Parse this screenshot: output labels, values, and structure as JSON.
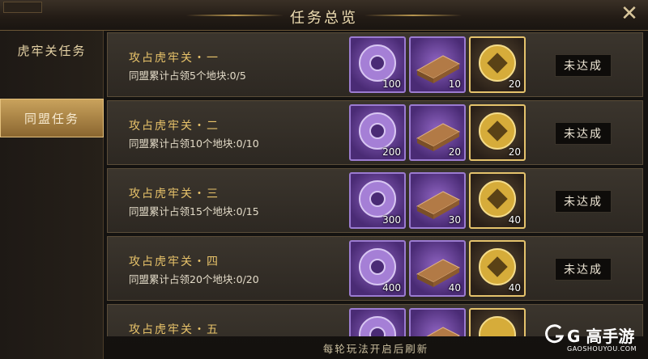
{
  "header": {
    "title": "任务总览",
    "close_icon": "close-icon"
  },
  "sidebar": {
    "items": [
      {
        "label": "虎牢关任务",
        "active": false
      },
      {
        "label": "同盟任务",
        "active": true
      }
    ]
  },
  "tasks": [
    {
      "title": "攻占虎牢关・一",
      "desc": "同盟累计占领5个地块:0/5",
      "rewards": [
        100,
        10,
        20
      ],
      "status": "未达成"
    },
    {
      "title": "攻占虎牢关・二",
      "desc": "同盟累计占领10个地块:0/10",
      "rewards": [
        200,
        20,
        20
      ],
      "status": "未达成"
    },
    {
      "title": "攻占虎牢关・三",
      "desc": "同盟累计占领15个地块:0/15",
      "rewards": [
        300,
        30,
        40
      ],
      "status": "未达成"
    },
    {
      "title": "攻占虎牢关・四",
      "desc": "同盟累计占领20个地块:0/20",
      "rewards": [
        400,
        40,
        40
      ],
      "status": "未达成"
    },
    {
      "title": "攻占虎牢关・五",
      "desc": "",
      "rewards": [
        "",
        "",
        ""
      ],
      "status": ""
    }
  ],
  "footer": {
    "text": "每轮玩法开启后刷新"
  },
  "watermark": {
    "brand": "G 高手游",
    "sub": "GAOSHOUYOU.COM"
  },
  "colors": {
    "accent_gold": "#e8c36a",
    "purple_item": "#6a43a0",
    "bg": "#141210"
  }
}
